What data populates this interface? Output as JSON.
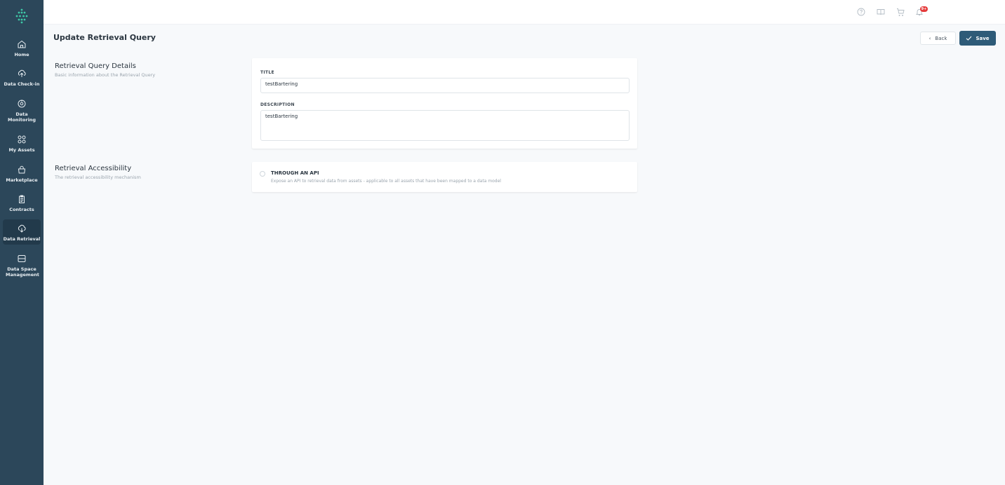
{
  "sidebar": {
    "items": [
      {
        "label": "Home",
        "icon": "home-icon"
      },
      {
        "label": "Data Check-in",
        "icon": "cloud-upload-icon"
      },
      {
        "label": "Data Monitoring",
        "icon": "monitoring-icon"
      },
      {
        "label": "My Assets",
        "icon": "grid-icon"
      },
      {
        "label": "Marketplace",
        "icon": "bag-icon"
      },
      {
        "label": "Contracts",
        "icon": "clipboard-icon"
      },
      {
        "label": "Data Retrieval",
        "icon": "cloud-download-icon"
      },
      {
        "label": "Data Space Management",
        "icon": "server-icon"
      }
    ],
    "active": "Data Retrieval"
  },
  "topbar": {
    "icons": [
      "help-icon",
      "book-icon",
      "cart-icon",
      "notification-icon"
    ],
    "notification_badge": "9+"
  },
  "header": {
    "title": "Update Retrieval Query",
    "back_label": "Back",
    "save_label": "Save"
  },
  "details": {
    "title": "Retrieval Query Details",
    "subtitle": "Basic information about the Retrieval Query",
    "title_field_label": "TITLE",
    "title_value": "testBartering",
    "description_field_label": "DESCRIPTION",
    "description_value": "testBartering"
  },
  "accessibility": {
    "title": "Retrieval Accessibility",
    "subtitle": "The retrieval accessibility mechanism",
    "option_title": "THROUGH AN API",
    "option_description": "Expose an API to retrieval data from assets - applicable to all assets that have been mapped to a data model"
  },
  "colors": {
    "sidebar": "#2c475a",
    "accent": "#2e5b78",
    "logo": "#3ec9a7",
    "badge": "#e53b3b"
  }
}
